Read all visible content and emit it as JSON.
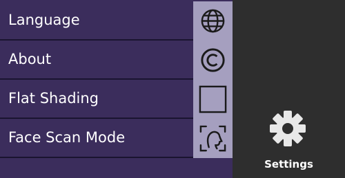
{
  "menu": {
    "items": [
      {
        "label": "Language",
        "icon": "globe-icon"
      },
      {
        "label": "About",
        "icon": "copyright-icon"
      },
      {
        "label": "Flat Shading",
        "icon": "checkbox-icon"
      },
      {
        "label": "Face Scan Mode",
        "icon": "face-scan-icon"
      }
    ]
  },
  "settings": {
    "label": "Settings",
    "icon": "gear-icon"
  },
  "colors": {
    "menu_bg": "#3b2d5c",
    "icon_bg": "#a59fbf",
    "panel_bg": "#2e2e2e",
    "gear": "#e8e8e8"
  }
}
